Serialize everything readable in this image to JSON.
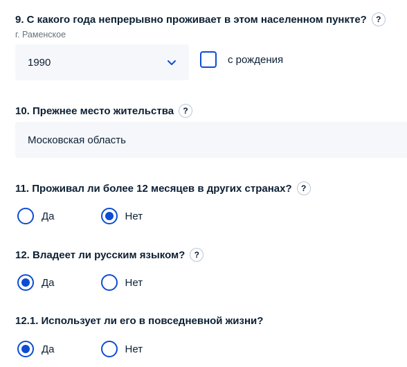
{
  "q9": {
    "title": "9. С какого года непрерывно проживает в этом населенном пункте?",
    "help": "?",
    "hint": "г. Раменское",
    "year_value": "1990",
    "checkbox_label": "с рождения",
    "checkbox_checked": false
  },
  "q10": {
    "title": "10. Прежнее место жительства",
    "help": "?",
    "value": "Московская область"
  },
  "q11": {
    "title": "11. Проживал ли более 12 месяцев в других странах?",
    "help": "?",
    "options": [
      {
        "label": "Да",
        "checked": false
      },
      {
        "label": "Нет",
        "checked": true
      }
    ]
  },
  "q12": {
    "title": "12. Владеет ли русским языком?",
    "help": "?",
    "options": [
      {
        "label": "Да",
        "checked": true
      },
      {
        "label": "Нет",
        "checked": false
      }
    ]
  },
  "q12_1": {
    "title": "12.1. Использует ли его в повседневной жизни?",
    "options": [
      {
        "label": "Да",
        "checked": true
      },
      {
        "label": "Нет",
        "checked": false
      }
    ]
  },
  "colors": {
    "accent": "#0d4cd3",
    "field_bg": "#f5f7fa",
    "text": "#0b1f33",
    "hint": "#66727f"
  }
}
